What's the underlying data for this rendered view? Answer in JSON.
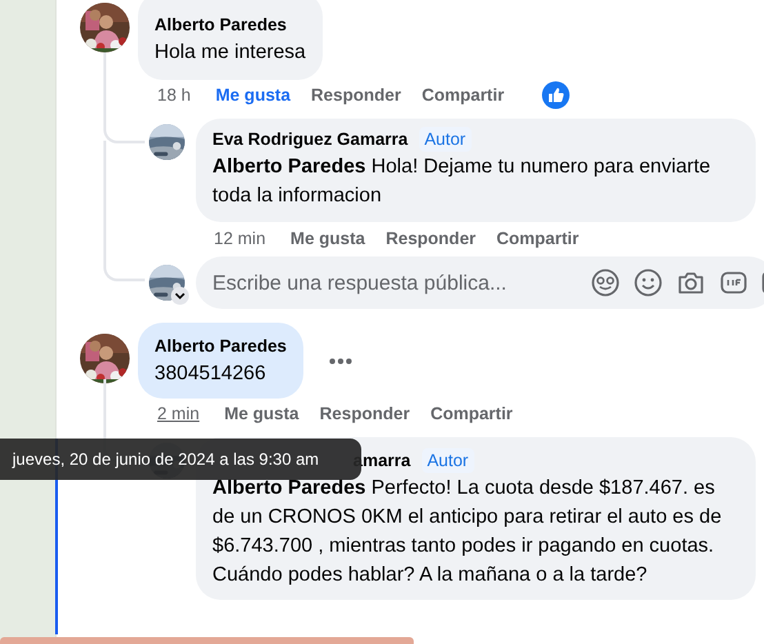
{
  "comments": [
    {
      "author": "Alberto Paredes",
      "text": "Hola me interesa",
      "highlighted": false,
      "more_menu": false,
      "time": "18 h",
      "time_hovered": false,
      "liked": true,
      "like_reaction": true,
      "actions": {
        "like": "Me gusta",
        "reply": "Responder",
        "share": "Compartir"
      },
      "replies": [
        {
          "kind": "comment",
          "author": "Eva Rodriguez Gamarra",
          "badge": "Autor",
          "text": "**Alberto Paredes** Hola! Dejame tu numero para enviarte toda la informacion",
          "time": "12 min",
          "time_hovered": false,
          "liked": false,
          "actions": {
            "like": "Me gusta",
            "reply": "Responder",
            "share": "Compartir"
          }
        },
        {
          "kind": "reply_box",
          "placeholder": "Escribe una respuesta pública..."
        }
      ]
    },
    {
      "author": "Alberto Paredes",
      "text": "3804514266",
      "highlighted": true,
      "more_menu": true,
      "time": "2 min",
      "time_hovered": true,
      "liked": false,
      "like_reaction": false,
      "actions": {
        "like": "Me gusta",
        "reply": "Responder",
        "share": "Compartir"
      },
      "replies": [
        {
          "kind": "comment",
          "author": "amarra",
          "author_covered": true,
          "badge": "Autor",
          "text": "**Alberto Paredes** Perfecto! La cuota desde $187.467. es de un CRONOS 0KM el anticipo para retirar el auto es de $6.743.700 , mientras tanto podes ir pagando en cuotas. Cuándo podes hablar? A la mañana o a la tarde?"
        }
      ]
    }
  ],
  "tooltip": {
    "text": "jueves, 20 de junio de 2024 a las 9:30 am"
  }
}
